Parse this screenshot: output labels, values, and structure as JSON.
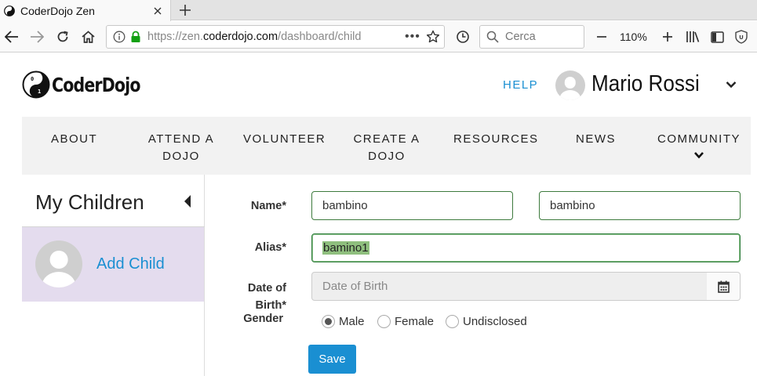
{
  "browser": {
    "tab_title": "CoderDojo Zen",
    "url_prefix": "https://zen.",
    "url_host": "coderdojo.com",
    "url_path": "/dashboard/child",
    "search_placeholder": "Cerca",
    "zoom_level": "110%"
  },
  "header": {
    "logo_text": "CoderDojo",
    "help_label": "HELP",
    "user_name": "Mario Rossi"
  },
  "nav": {
    "items": [
      {
        "label": "ABOUT"
      },
      {
        "label": "ATTEND A DOJO"
      },
      {
        "label": "VOLUNTEER"
      },
      {
        "label": "CREATE A DOJO"
      },
      {
        "label": "RESOURCES"
      },
      {
        "label": "NEWS"
      },
      {
        "label": "COMMUNITY"
      }
    ]
  },
  "sidebar": {
    "title": "My Children",
    "add_child_label": "Add Child"
  },
  "form": {
    "name_label": "Name*",
    "first_name_value": "bambino",
    "last_name_value": "bambino",
    "alias_label": "Alias*",
    "alias_value": "bamino1",
    "dob_label": "Date of Birth*",
    "dob_placeholder": "Date of Birth",
    "gender_label": "Gender",
    "gender_options": [
      {
        "label": "Male",
        "selected": true
      },
      {
        "label": "Female",
        "selected": false
      },
      {
        "label": "Undisclosed",
        "selected": false
      }
    ],
    "save_label": "Save"
  },
  "colors": {
    "accent": "#1a8fd2",
    "selected_row": "#e4dcee",
    "input_border_valid": "#3d7a3d"
  }
}
